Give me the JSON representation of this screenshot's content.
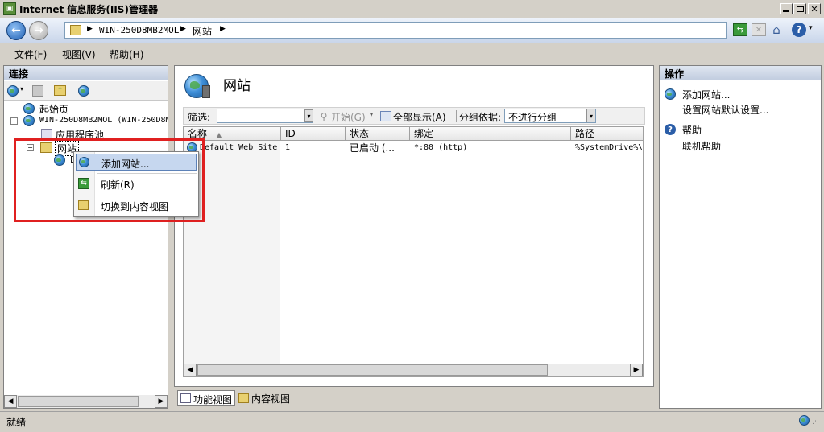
{
  "window": {
    "title": "Internet 信息服务(IIS)管理器"
  },
  "address": {
    "segments": [
      "WIN-250D8MB2MOL",
      "网站"
    ]
  },
  "menu": [
    {
      "label": "文件(F)"
    },
    {
      "label": "视图(V)"
    },
    {
      "label": "帮助(H)"
    }
  ],
  "connections": {
    "title": "连接",
    "tree": {
      "start": "起始页",
      "server": "WIN-250D8MB2MOL (WIN-250D8M",
      "apppools": "应用程序池",
      "sites": "网站",
      "child_partial": "D"
    }
  },
  "context_menu": {
    "items": [
      {
        "label": "添加网站..."
      },
      {
        "label": "刷新(R)"
      },
      {
        "label": "切换到内容视图"
      }
    ]
  },
  "main": {
    "title": "网站",
    "filter_label": "筛选:",
    "start_label": "开始(G)",
    "show_all_label": "全部显示(A)",
    "group_label": "分组依据:",
    "group_value": "不进行分组",
    "columns": [
      "名称",
      "ID",
      "状态",
      "绑定",
      "路径"
    ],
    "rows": [
      {
        "name": "Default Web Site",
        "id": "1",
        "status": "已启动 (...",
        "binding": "*:80 (http)",
        "path": "%SystemDrive%\\"
      }
    ],
    "tabs": [
      {
        "label": "功能视图"
      },
      {
        "label": "内容视图"
      }
    ]
  },
  "actions": {
    "title": "操作",
    "add_site": "添加网站...",
    "set_defaults": "设置网站默认设置...",
    "help": "帮助",
    "online_help": "联机帮助"
  },
  "status": {
    "text": "就绪"
  }
}
